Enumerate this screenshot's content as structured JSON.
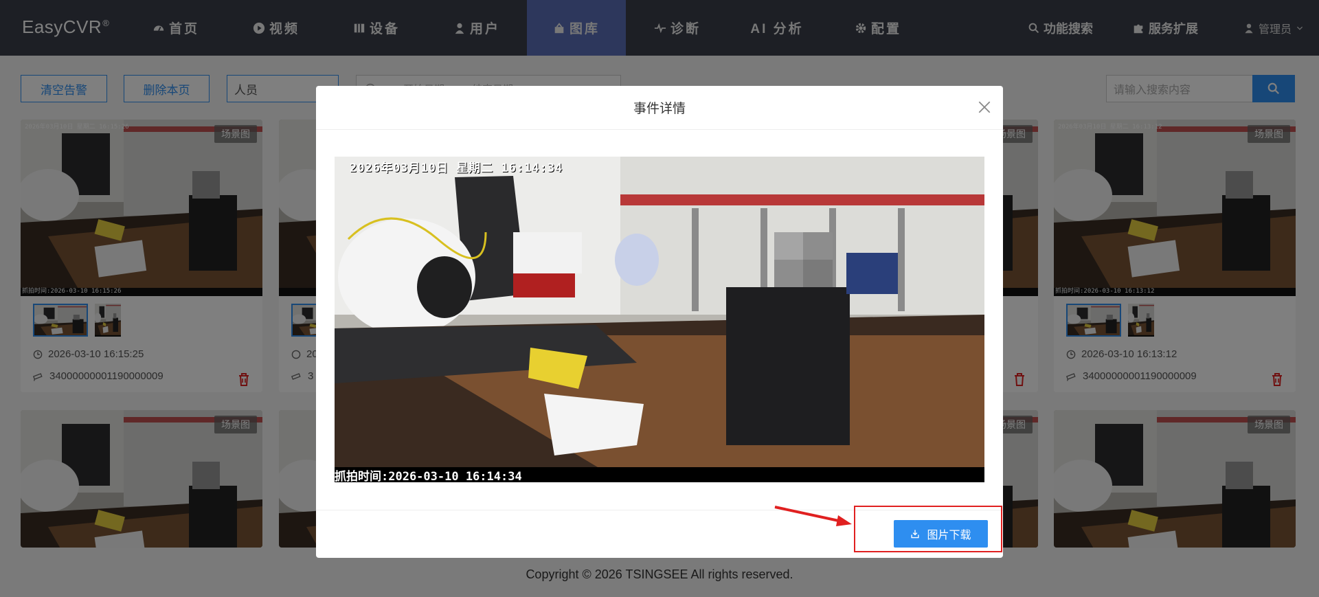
{
  "app": {
    "logo": "EasyCVR",
    "logo_mark": "®"
  },
  "nav": {
    "items": [
      {
        "label": "首页",
        "icon": "dashboard-icon"
      },
      {
        "label": "视频",
        "icon": "play-icon"
      },
      {
        "label": "设备",
        "icon": "device-icon"
      },
      {
        "label": "用户",
        "icon": "user-icon"
      },
      {
        "label": "图库",
        "icon": "gallery-icon",
        "active": true
      },
      {
        "label": "诊断",
        "icon": "pulse-icon"
      },
      {
        "label": "AI 分析",
        "icon": ""
      },
      {
        "label": "配置",
        "icon": "gear-icon"
      }
    ],
    "right": {
      "search": "功能搜索",
      "extend": "服务扩展",
      "user": "管理员"
    }
  },
  "toolbar": {
    "clear_alerts": "清空告警",
    "delete_page": "删除本页",
    "type_select": "人员",
    "date_start": "开始日期",
    "date_end": "结束日期",
    "search_placeholder": "请输入搜索内容"
  },
  "cards": {
    "scene_tag": "场景图",
    "left": {
      "time": "2026-03-10 16:15:25",
      "device": "34000000001190000009",
      "stamp": "2026年03月10日 星期二 16:15:26",
      "capture": "抓拍时间:2026-03-10 16:15:26"
    },
    "right": {
      "time": "2026-03-10 16:13:12",
      "device": "34000000001190000009",
      "stamp": "2026年03月10日 星期二 16:13:12",
      "capture": "抓拍时间:2026-03-10 16:13:12"
    },
    "partial_time": "20",
    "partial_device": "3"
  },
  "modal": {
    "title": "事件详情",
    "stamp_top": "2026年03月10日  星期二  16:14:34",
    "stamp_bottom": "抓拍时间:2026-03-10 16:14:34",
    "download": "图片下载"
  },
  "footer": {
    "copyright": "Copyright © 2026 TSINGSEE All rights reserved."
  },
  "colors": {
    "primary": "#2e8ef0",
    "nav_bg": "#3a3f4b",
    "nav_active": "#5a6fb8",
    "danger": "#e02020"
  }
}
